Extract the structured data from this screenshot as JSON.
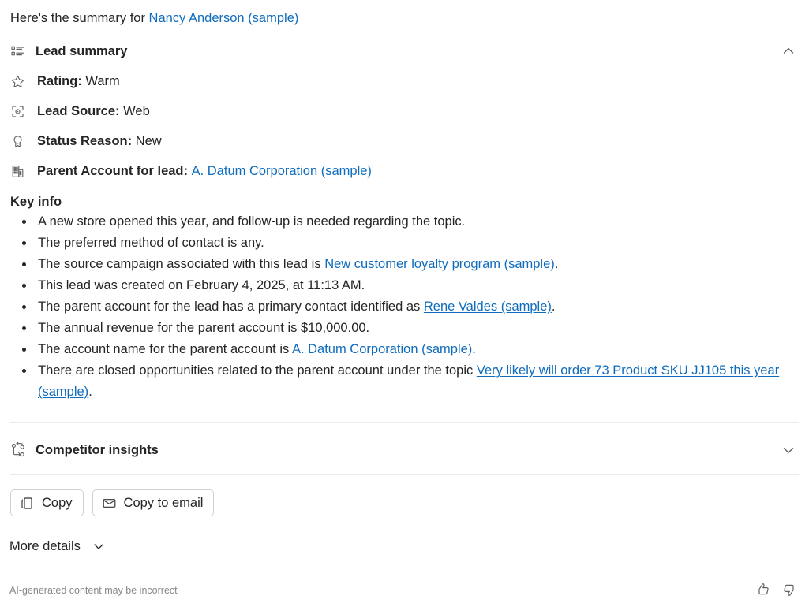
{
  "intro": {
    "prefix": "Here's the summary for ",
    "link": "Nancy Anderson (sample)"
  },
  "lead_summary": {
    "icon": "list-summary-icon",
    "title": "Lead summary",
    "collapse_icon": "chevron-up-icon",
    "facts": [
      {
        "icon": "star-icon",
        "label": "Rating:",
        "value": "Warm"
      },
      {
        "icon": "scan-icon",
        "label": "Lead Source:",
        "value": "Web"
      },
      {
        "icon": "ribbon-icon",
        "label": "Status Reason:",
        "value": "New"
      },
      {
        "icon": "building-icon",
        "label": "Parent Account for lead:",
        "value": "A. Datum Corporation (sample)",
        "value_is_link": true
      }
    ]
  },
  "key_info": {
    "title": "Key info",
    "items": [
      {
        "pre": "A new store opened this year, and follow-up is needed regarding the topic.",
        "link": "",
        "post": ""
      },
      {
        "pre": "The preferred method of contact is any.",
        "link": "",
        "post": ""
      },
      {
        "pre": "The source campaign associated with this lead is ",
        "link": "New customer loyalty program (sample)",
        "post": "."
      },
      {
        "pre": "This lead was created on February 4, 2025, at 11:13 AM.",
        "link": "",
        "post": ""
      },
      {
        "pre": "The parent account for the lead has a primary contact identified as ",
        "link": "Rene Valdes (sample)",
        "post": "."
      },
      {
        "pre": "The annual revenue for the parent account is $10,000.00.",
        "link": "",
        "post": ""
      },
      {
        "pre": "The account name for the parent account is ",
        "link": "A. Datum Corporation (sample)",
        "post": "."
      },
      {
        "pre": "There are closed opportunities related to the parent account under the topic ",
        "link": "Very likely will order 73 Product SKU JJ105 this year (sample)",
        "post": "."
      }
    ]
  },
  "competitor_insights": {
    "icon": "competitor-compare-icon",
    "title": "Competitor insights",
    "expand_icon": "chevron-down-icon"
  },
  "actions": {
    "copy": {
      "icon": "copy-icon",
      "label": "Copy"
    },
    "copy_to_email": {
      "icon": "mail-icon",
      "label": "Copy to email"
    },
    "more_details": {
      "label": "More details",
      "icon": "chevron-down-icon"
    }
  },
  "footer": {
    "disclaimer": "AI-generated content may be incorrect",
    "thumbs_up": "thumbs-up-icon",
    "thumbs_down": "thumbs-down-icon"
  },
  "colors": {
    "link": "#0f6cbd",
    "text": "#242424",
    "muted": "#8a8886",
    "divider": "#ebebeb",
    "border": "#d1d1d1",
    "icon": "#616161"
  }
}
